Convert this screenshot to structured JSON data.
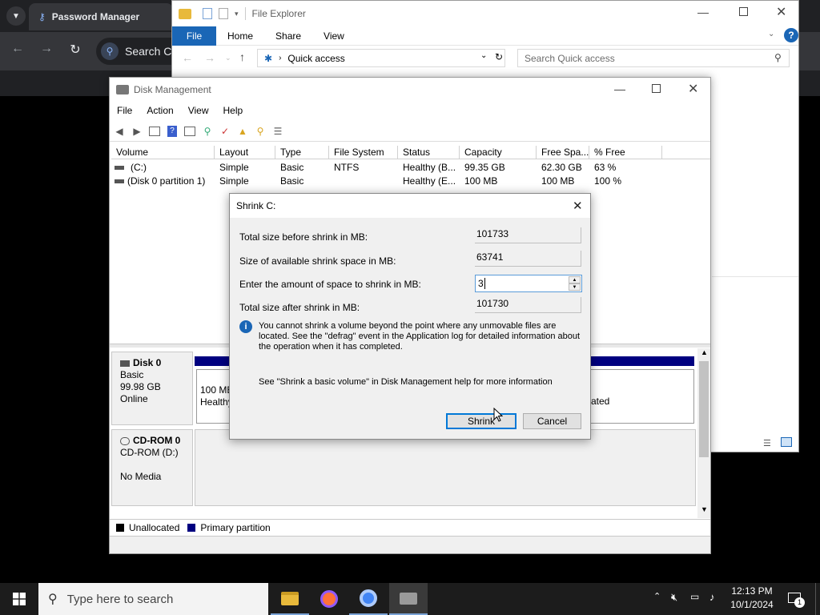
{
  "browser": {
    "tab_title": "Password Manager",
    "omnibox_partial": "Search Co"
  },
  "explorer": {
    "title": "File Explorer",
    "ribbon_tabs": [
      "File",
      "Home",
      "Share",
      "View"
    ],
    "address": "Quick access",
    "search_placeholder": "Search Quick access"
  },
  "diskmgmt": {
    "title": "Disk Management",
    "menu": [
      "File",
      "Action",
      "View",
      "Help"
    ],
    "columns": [
      "Volume",
      "Layout",
      "Type",
      "File System",
      "Status",
      "Capacity",
      "Free Spa...",
      "% Free"
    ],
    "rows": [
      {
        "volume": "(C:)",
        "layout": "Simple",
        "type": "Basic",
        "fs": "NTFS",
        "status": "Healthy (B...",
        "capacity": "99.35 GB",
        "free": "62.30 GB",
        "pct": "63 %"
      },
      {
        "volume": "(Disk 0 partition 1)",
        "layout": "Simple",
        "type": "Basic",
        "fs": "",
        "status": "Healthy (E...",
        "capacity": "100 MB",
        "free": "100 MB",
        "pct": "100 %"
      }
    ],
    "disk0": {
      "name": "Disk 0",
      "type": "Basic",
      "size": "99.98 GB",
      "state": "Online",
      "part1_size": "100 ME",
      "part1_status": "Healthy",
      "part2_status_partial": "ated"
    },
    "cdrom": {
      "name": "CD-ROM 0",
      "label": "CD-ROM (D:)",
      "media": "No Media"
    },
    "legend": {
      "unallocated": "Unallocated",
      "primary": "Primary partition"
    },
    "colors": {
      "unallocated": "#000000",
      "primary": "#000080"
    }
  },
  "dialog": {
    "title": "Shrink C:",
    "total_before_label": "Total size before shrink in MB:",
    "total_before_value": "101733",
    "available_label": "Size of available shrink space in MB:",
    "available_value": "63741",
    "amount_label": "Enter the amount of space to shrink in MB:",
    "amount_value": "3",
    "after_label": "Total size after shrink in MB:",
    "after_value": "101730",
    "info_text": "You cannot shrink a volume beyond the point where any unmovable files are located. See the \"defrag\" event in the Application log for detailed information about the operation when it has completed.",
    "help_text": "See \"Shrink a basic volume\" in Disk Management help for more information",
    "shrink_label": "Shrink",
    "cancel_label": "Cancel"
  },
  "taskbar": {
    "search_placeholder": "Type here to search",
    "time": "12:13 PM",
    "date": "10/1/2024",
    "notification_count": "1"
  }
}
